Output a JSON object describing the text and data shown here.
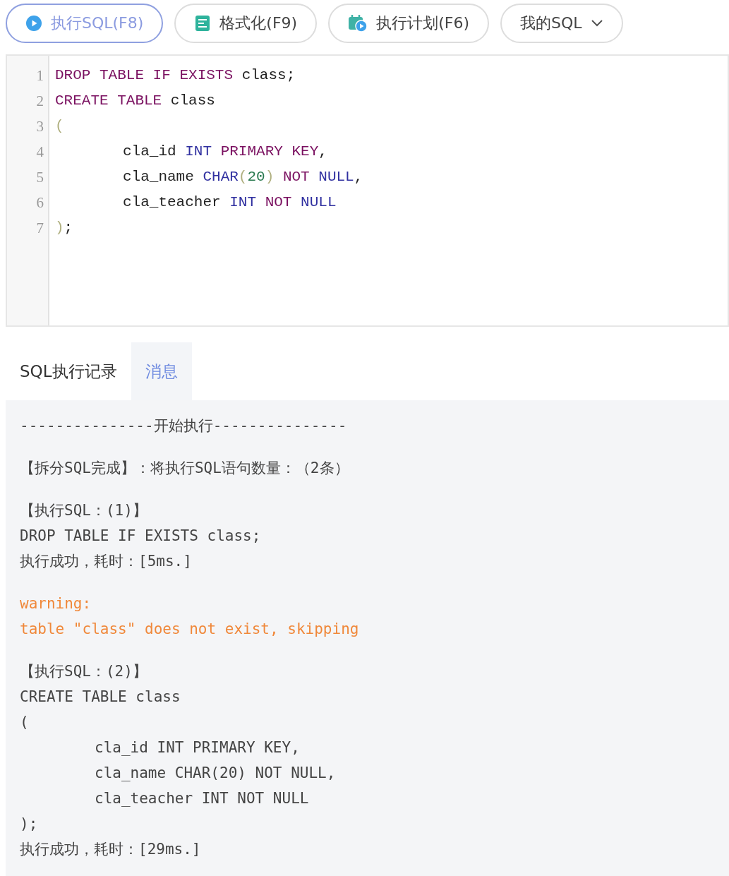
{
  "toolbar": {
    "buttons": [
      {
        "label": "执行SQL(F8)",
        "kind": "run"
      },
      {
        "label": "格式化(F9)",
        "kind": "format"
      },
      {
        "label": "执行计划(F6)",
        "kind": "plan"
      },
      {
        "label": "我的SQL",
        "kind": "dropdown"
      }
    ]
  },
  "editor": {
    "lines": [
      {
        "number": "1",
        "indented": false,
        "tokens": [
          {
            "text": "DROP TABLE IF EXISTS",
            "kind": "keyword"
          },
          {
            "text": " class;",
            "kind": "plain"
          }
        ]
      },
      {
        "number": "2",
        "indented": false,
        "tokens": [
          {
            "text": "CREATE TABLE",
            "kind": "keyword"
          },
          {
            "text": " class",
            "kind": "plain"
          }
        ]
      },
      {
        "number": "3",
        "indented": false,
        "tokens": [
          {
            "text": "(",
            "kind": "bracket"
          }
        ]
      },
      {
        "number": "4",
        "indented": true,
        "tokens": [
          {
            "text": "cla_id ",
            "kind": "plain"
          },
          {
            "text": "INT",
            "kind": "datatype"
          },
          {
            "text": " PRIMARY KEY",
            "kind": "keyword"
          },
          {
            "text": ",",
            "kind": "plain"
          }
        ]
      },
      {
        "number": "5",
        "indented": true,
        "tokens": [
          {
            "text": "cla_name ",
            "kind": "plain"
          },
          {
            "text": "CHAR",
            "kind": "datatype"
          },
          {
            "text": "(",
            "kind": "bracket"
          },
          {
            "text": "20",
            "kind": "number"
          },
          {
            "text": ")",
            "kind": "bracket"
          },
          {
            "text": " NOT",
            "kind": "keyword"
          },
          {
            "text": " NULL",
            "kind": "datatype"
          },
          {
            "text": ",",
            "kind": "plain"
          }
        ]
      },
      {
        "number": "6",
        "indented": true,
        "tokens": [
          {
            "text": "cla_teacher ",
            "kind": "plain"
          },
          {
            "text": "INT",
            "kind": "datatype"
          },
          {
            "text": " NOT",
            "kind": "keyword"
          },
          {
            "text": " NULL",
            "kind": "datatype"
          }
        ]
      },
      {
        "number": "7",
        "indented": false,
        "tokens": [
          {
            "text": ")",
            "kind": "bracket"
          },
          {
            "text": ";",
            "kind": "plain"
          }
        ]
      }
    ]
  },
  "result_tabs": [
    {
      "label": "SQL执行记录",
      "selected": false
    },
    {
      "label": "消息",
      "selected": true
    }
  ],
  "messages": [
    {
      "lines": [
        {
          "text": "---------------开始执行---------------",
          "kind": "plain",
          "indented": false
        }
      ]
    },
    {
      "lines": [
        {
          "text": "【拆分SQL完成】：将执行SQL语句数量：（2条）",
          "kind": "plain",
          "indented": false
        }
      ]
    },
    {
      "lines": [
        {
          "text": "【执行SQL：(1)】",
          "kind": "plain",
          "indented": false
        },
        {
          "text": "DROP TABLE IF EXISTS class;",
          "kind": "plain",
          "indented": false
        },
        {
          "text": "执行成功，耗时：[5ms.]",
          "kind": "plain",
          "indented": false
        }
      ]
    },
    {
      "lines": [
        {
          "text": "warning:",
          "kind": "warning",
          "indented": false
        },
        {
          "text": "table \"class\" does not exist, skipping",
          "kind": "warning",
          "indented": false
        }
      ]
    },
    {
      "lines": [
        {
          "text": "【执行SQL：(2)】",
          "kind": "plain",
          "indented": false
        },
        {
          "text": "CREATE TABLE class",
          "kind": "plain",
          "indented": false
        },
        {
          "text": "(",
          "kind": "plain",
          "indented": false
        },
        {
          "text": "cla_id INT PRIMARY KEY,",
          "kind": "plain",
          "indented": true
        },
        {
          "text": "cla_name CHAR(20) NOT NULL,",
          "kind": "plain",
          "indented": true
        },
        {
          "text": "cla_teacher INT NOT NULL",
          "kind": "plain",
          "indented": true
        },
        {
          "text": ");",
          "kind": "plain",
          "indented": false
        },
        {
          "text": "执行成功，耗时：[29ms.]",
          "kind": "plain",
          "indented": false
        }
      ]
    }
  ]
}
